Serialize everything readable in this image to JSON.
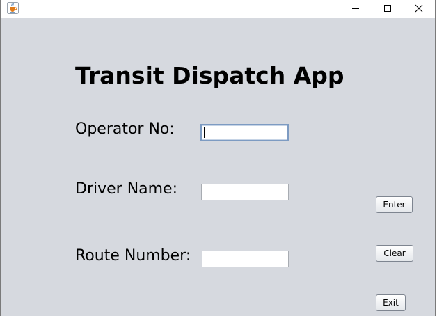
{
  "window": {
    "icon": "java-coffee-cup-icon",
    "controls": {
      "minimize": "minimize-icon",
      "maximize": "maximize-icon",
      "close": "close-icon"
    }
  },
  "app": {
    "title": "Transit Dispatch App"
  },
  "form": {
    "operator_label": "Operator No:",
    "operator_value": "",
    "driver_label": "Driver Name:",
    "driver_value": "",
    "route_label": "Route Number:",
    "route_value": ""
  },
  "buttons": {
    "enter": "Enter",
    "clear": "Clear",
    "exit": "Exit"
  },
  "colors": {
    "panel_background": "#d6d9df",
    "focus_border": "#7d9bc2"
  }
}
